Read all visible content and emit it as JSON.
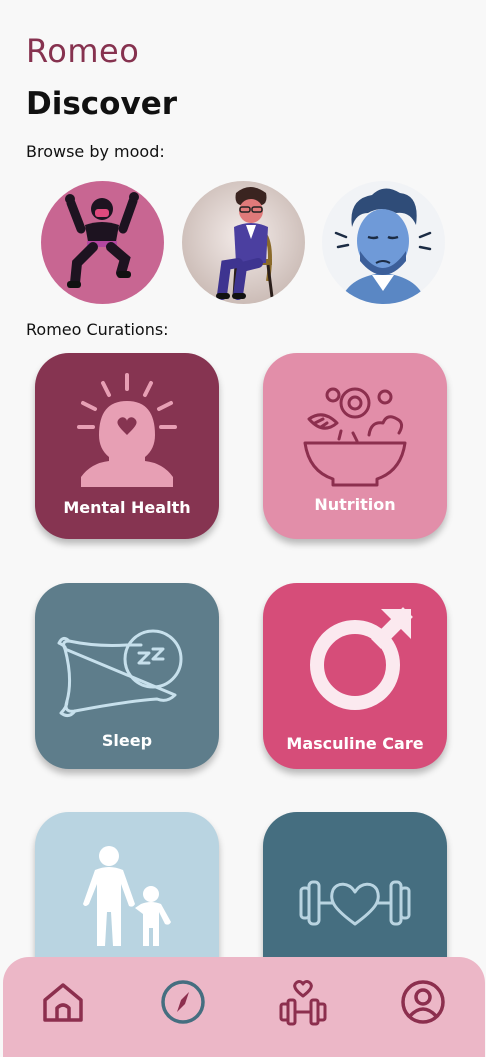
{
  "app": {
    "brand": "Romeo",
    "page_title": "Discover"
  },
  "sections": {
    "browse_by_mood": "Browse by mood:",
    "curations": "Romeo Curations:"
  },
  "moods": [
    {
      "icon": "dancing-man-avatar"
    },
    {
      "icon": "seated-man-avatar"
    },
    {
      "icon": "stressed-man-avatar"
    }
  ],
  "curations": [
    {
      "label": "Mental Health",
      "icon": "mind-heart-icon",
      "color": "#863451"
    },
    {
      "label": "Nutrition",
      "icon": "salad-bowl-icon",
      "color": "#e28ea9"
    },
    {
      "label": "Sleep",
      "icon": "pillow-sleep-icon",
      "color": "#5e7d8b"
    },
    {
      "label": "Masculine Care",
      "icon": "male-symbol-icon",
      "color": "#d64d79"
    },
    {
      "label": "",
      "icon": "parent-child-icon",
      "color": "#b9d4e1"
    },
    {
      "label": "",
      "icon": "dumbbell-heart-icon",
      "color": "#456e80"
    }
  ],
  "bottom_nav": [
    {
      "icon": "home-icon"
    },
    {
      "icon": "compass-icon"
    },
    {
      "icon": "fitness-heart-icon"
    },
    {
      "icon": "profile-icon"
    }
  ],
  "colors": {
    "brand": "#86324f",
    "nav_bg": "#ecb7c7",
    "background": "#f8f8f8"
  }
}
